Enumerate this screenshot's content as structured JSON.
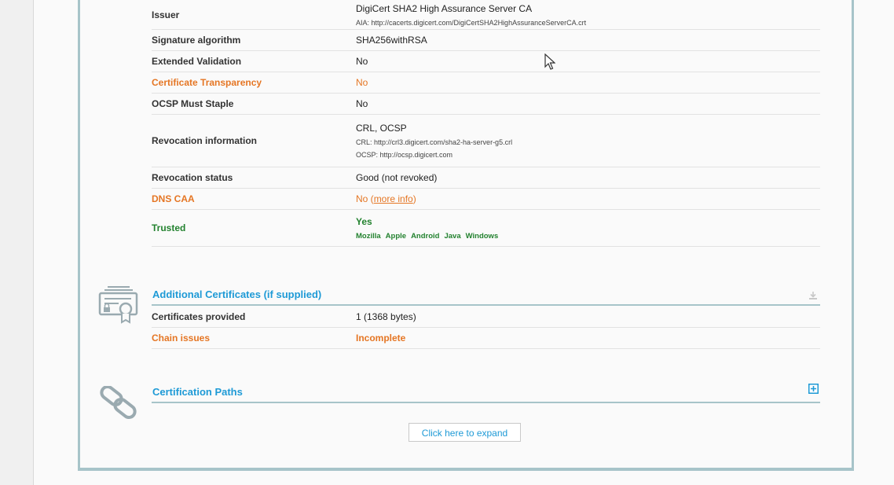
{
  "cert_rows": [
    {
      "label": "Issuer",
      "value": "DigiCert SHA2 High Assurance Server CA",
      "sub1": "AIA: http://cacerts.digicert.com/DigiCertSHA2HighAssuranceServerCA.crt"
    },
    {
      "label": "Signature algorithm",
      "value": "SHA256withRSA"
    },
    {
      "label": "Extended Validation",
      "value": "No"
    },
    {
      "label": "Certificate Transparency",
      "value": "No"
    },
    {
      "label": "OCSP Must Staple",
      "value": "No"
    },
    {
      "label": "Revocation information",
      "value": "CRL, OCSP",
      "sub1": "CRL: http://crl3.digicert.com/sha2-ha-server-g5.crl",
      "sub2": "OCSP: http://ocsp.digicert.com"
    },
    {
      "label": "Revocation status",
      "value": "Good (not revoked)"
    },
    {
      "label": "DNS CAA",
      "value": "No",
      "link_open": " (",
      "link": "more info",
      "link_close": ")"
    },
    {
      "label": "Trusted",
      "value": "Yes",
      "stores": [
        "Mozilla",
        "Apple",
        "Android",
        "Java",
        "Windows"
      ]
    }
  ],
  "additional": {
    "title": "Additional Certificates (if supplied)",
    "rows": [
      {
        "label": "Certificates provided",
        "value": "1 (1368 bytes)"
      },
      {
        "label": "Chain issues",
        "value": "Incomplete"
      }
    ]
  },
  "paths": {
    "title": "Certification Paths",
    "expand_label": "Click here to expand"
  },
  "colors": {
    "accent": "#1e9ad6",
    "warning": "#e57624",
    "good": "#23822f",
    "border": "#a7c4c9"
  },
  "icons": [
    "certificate-icon",
    "download-icon",
    "chain-link-icon",
    "plus-box-icon",
    "mouse-cursor-icon"
  ]
}
